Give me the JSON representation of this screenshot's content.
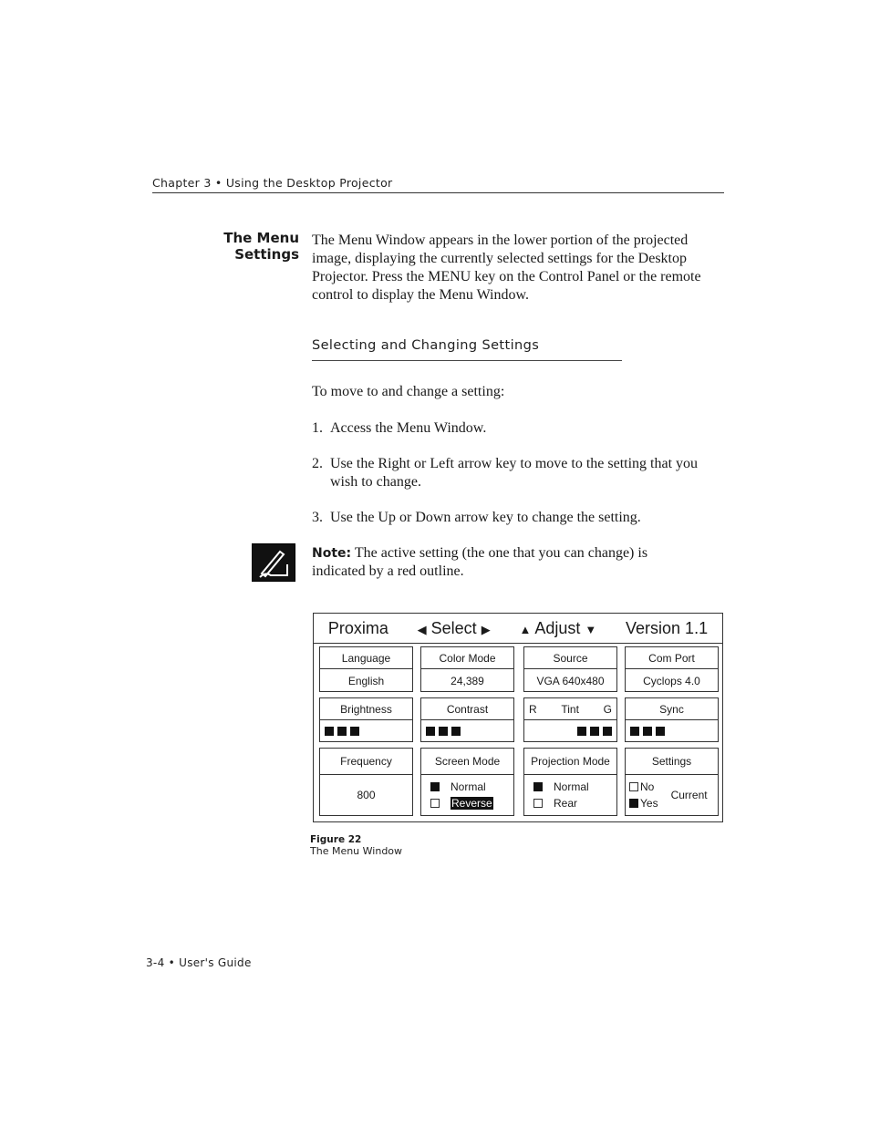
{
  "running_header": "Chapter 3  •  Using the Desktop Projector",
  "section": {
    "heading_line1": "The Menu",
    "heading_line2": "Settings",
    "intro": "The Menu Window appears in the lower portion of the projected image, displaying the currently selected settings for the Desktop Projector. Press the MENU key on the Control Panel or the remote control to display the Menu Window."
  },
  "subsection": {
    "heading": "Selecting and Changing Settings",
    "lead": "To move to and change a setting:",
    "steps": [
      {
        "num": "1.",
        "text": "Access the Menu Window."
      },
      {
        "num": "2.",
        "text": "Use the Right or Left arrow key to move to the setting that you wish to change."
      },
      {
        "num": "3.",
        "text": "Use the Up or Down arrow key to change the setting."
      }
    ]
  },
  "note": {
    "icon": "note-pencil-icon",
    "label": "Note:",
    "text": " The active setting (the one that you can change) is indicated by a red outline."
  },
  "menu_window": {
    "title": "Proxima",
    "select": "Select",
    "adjust": "Adjust",
    "version": "Version 1.1",
    "cells": {
      "language": {
        "label": "Language",
        "value": "English"
      },
      "color_mode": {
        "label": "Color Mode",
        "value": "24,389"
      },
      "source": {
        "label": "Source",
        "value": "VGA 640x480"
      },
      "com_port": {
        "label": "Com Port",
        "value": "Cyclops 4.0"
      },
      "brightness": {
        "label": "Brightness"
      },
      "contrast": {
        "label": "Contrast"
      },
      "tint": {
        "label": "Tint",
        "left": "R",
        "right": "G"
      },
      "sync": {
        "label": "Sync"
      },
      "frequency": {
        "label": "Frequency",
        "value": "800"
      },
      "screen_mode": {
        "label": "Screen Mode",
        "options": [
          "Normal",
          "Reverse"
        ],
        "selected": "Normal",
        "highlighted": "Reverse"
      },
      "projection_mode": {
        "label": "Projection Mode",
        "options": [
          "Normal",
          "Rear"
        ],
        "selected": "Normal"
      },
      "settings": {
        "label": "Settings",
        "options": [
          "No",
          "Yes"
        ],
        "selected": "Yes",
        "side_label": "Current"
      }
    }
  },
  "figure": {
    "label": "Figure 22",
    "caption": "The Menu Window"
  },
  "footer": "3-4  •  User's Guide"
}
